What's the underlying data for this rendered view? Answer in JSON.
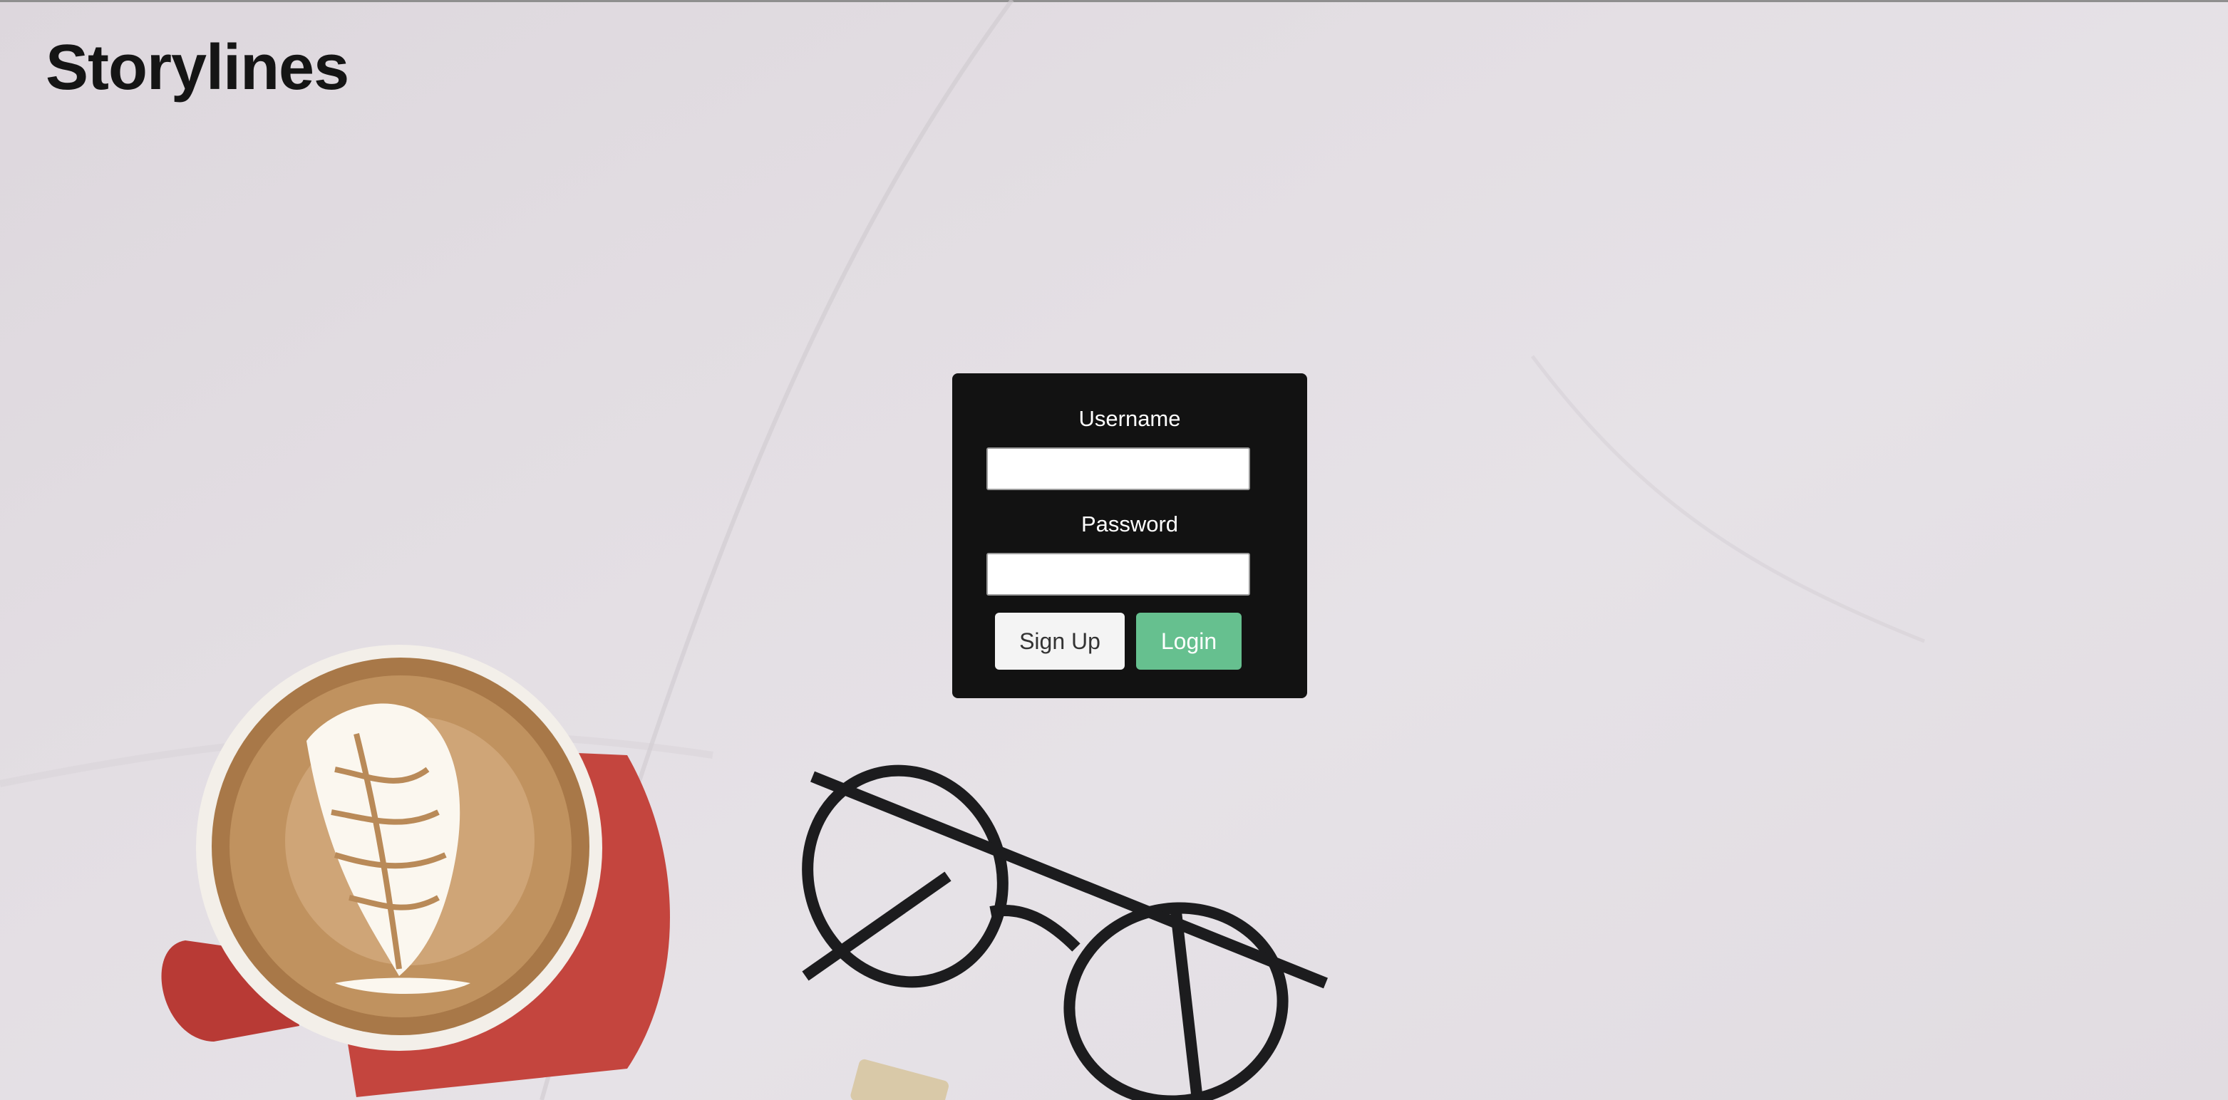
{
  "app": {
    "title": "Storylines"
  },
  "login_form": {
    "username_label": "Username",
    "username_value": "",
    "password_label": "Password",
    "password_value": "",
    "signup_label": "Sign Up",
    "login_label": "Login"
  },
  "colors": {
    "card_background": "#121212",
    "login_button": "#66c08f",
    "signup_button": "#f4f4f4",
    "brand_text": "#151515"
  },
  "background_photo": {
    "objects": [
      "coffee-cup",
      "latte-art",
      "eyeglasses"
    ]
  }
}
